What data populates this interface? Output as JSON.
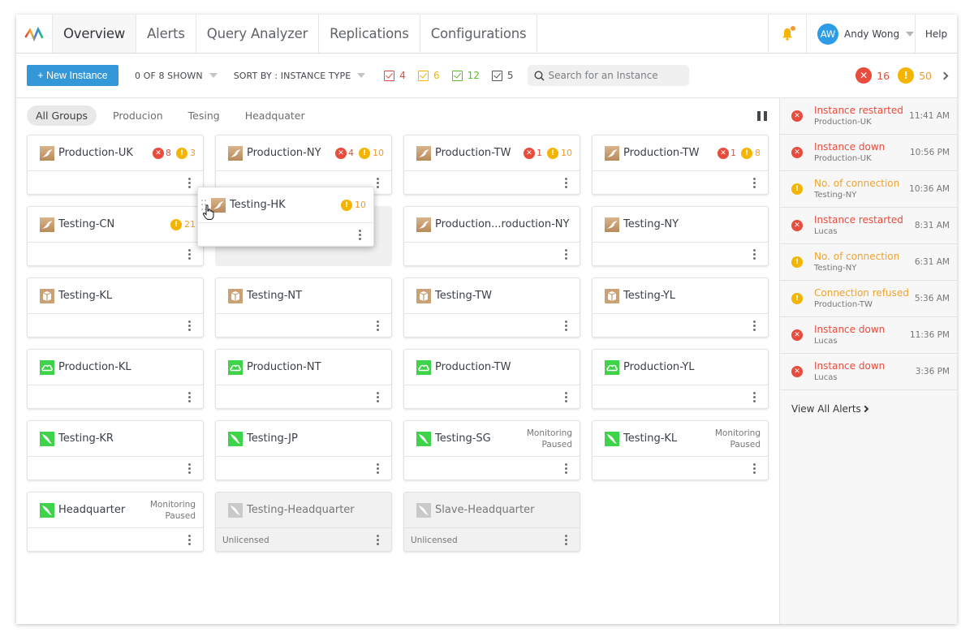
{
  "nav": {
    "tabs": [
      {
        "label": "Overview",
        "active": true
      },
      {
        "label": "Alerts",
        "active": false
      },
      {
        "label": "Query Analyzer",
        "active": false
      },
      {
        "label": "Replications",
        "active": false
      },
      {
        "label": "Configurations",
        "active": false
      }
    ],
    "user": {
      "initials": "AW",
      "name": "Andy Wong"
    },
    "help_label": "Help",
    "notification_dot": true
  },
  "toolbar": {
    "new_instance_label": "+ New Instance",
    "shown_label": "0 OF 8 SHOWN",
    "sort_label": "SORT BY : INSTANCE TYPE",
    "filters": [
      {
        "color": "#e84c3d",
        "count": "4",
        "checked": true
      },
      {
        "color": "#f4b400",
        "count": "6",
        "checked": true
      },
      {
        "color": "#5cbd2d",
        "count": "12",
        "checked": true
      },
      {
        "color": "#555555",
        "count": "5",
        "checked": true
      }
    ],
    "search_placeholder": "Search for an Instance",
    "summary": {
      "errors": "16",
      "warnings": "50"
    }
  },
  "groups": [
    {
      "label": "All Groups",
      "active": true
    },
    {
      "label": "Producion",
      "active": false
    },
    {
      "label": "Tesing",
      "active": false
    },
    {
      "label": "Headquater",
      "active": false
    }
  ],
  "instances": [
    {
      "name": "Production-UK",
      "type": "mariadb",
      "errors": "8",
      "warnings": "3"
    },
    {
      "name": "Production-NY",
      "type": "mariadb",
      "errors": "4",
      "warnings": "10"
    },
    {
      "name": "Production-TW",
      "type": "mariadb",
      "errors": "1",
      "warnings": "10"
    },
    {
      "name": "Production-TW",
      "type": "mariadb",
      "errors": "1",
      "warnings": "8"
    },
    {
      "name": "Testing-CN",
      "type": "mariadb",
      "warnings": "21"
    },
    {
      "name": "Production...roduction-NY",
      "type": "mariadb"
    },
    {
      "name": "Testing-NY",
      "type": "mariadb"
    },
    {
      "name": "Testing-KL",
      "type": "box"
    },
    {
      "name": "Testing-NT",
      "type": "box"
    },
    {
      "name": "Testing-TW",
      "type": "box"
    },
    {
      "name": "Testing-YL",
      "type": "box"
    },
    {
      "name": "Production-KL",
      "type": "cloud"
    },
    {
      "name": "Production-NT",
      "type": "cloud"
    },
    {
      "name": "Production-TW",
      "type": "cloud"
    },
    {
      "name": "Production-YL",
      "type": "cloud"
    },
    {
      "name": "Testing-KR",
      "type": "mysql"
    },
    {
      "name": "Testing-JP",
      "type": "mysql"
    },
    {
      "name": "Testing-SG",
      "type": "mysql",
      "status": [
        "Monitoring",
        "Paused"
      ]
    },
    {
      "name": "Testing-KL",
      "type": "mysql",
      "status": [
        "Monitoring",
        "Paused"
      ]
    },
    {
      "name": "Headquarter",
      "type": "mysql",
      "status": [
        "Monitoring",
        "Paused"
      ]
    },
    {
      "name": "Testing-Headquarter",
      "type": "mysql-disabled",
      "footer": "Unlicensed"
    },
    {
      "name": "Slave-Headquarter",
      "type": "mysql-disabled",
      "footer": "Unlicensed"
    }
  ],
  "dragging": {
    "name": "Testing-HK",
    "type": "mariadb",
    "warnings": "10"
  },
  "alerts": [
    {
      "title": "Instance restarted",
      "instance": "Production-UK",
      "time": "11:41 AM",
      "level": "err"
    },
    {
      "title": "Instance down",
      "instance": "Production-UK",
      "time": "10:56 PM",
      "level": "err"
    },
    {
      "title": "No. of connection",
      "instance": "Testing-NY",
      "time": "10:36 AM",
      "level": "warn"
    },
    {
      "title": "Instance restarted",
      "instance": "Lucas",
      "time": "8:31 AM",
      "level": "err"
    },
    {
      "title": "No. of connection",
      "instance": "Testing-NY",
      "time": "6:31 AM",
      "level": "warn"
    },
    {
      "title": "Connection refused",
      "instance": "Production-TW",
      "time": "5:36 AM",
      "level": "warn"
    },
    {
      "title": "Instance down",
      "instance": "Lucas",
      "time": "11:36 PM",
      "level": "err"
    },
    {
      "title": "Instance down",
      "instance": "Lucas",
      "time": "3:36 PM",
      "level": "err"
    }
  ],
  "view_all_label": "View All Alerts",
  "colors": {
    "accent": "#3498d8",
    "error": "#e84c3d",
    "warning": "#f4b400",
    "avatar": "#2e9be6"
  }
}
